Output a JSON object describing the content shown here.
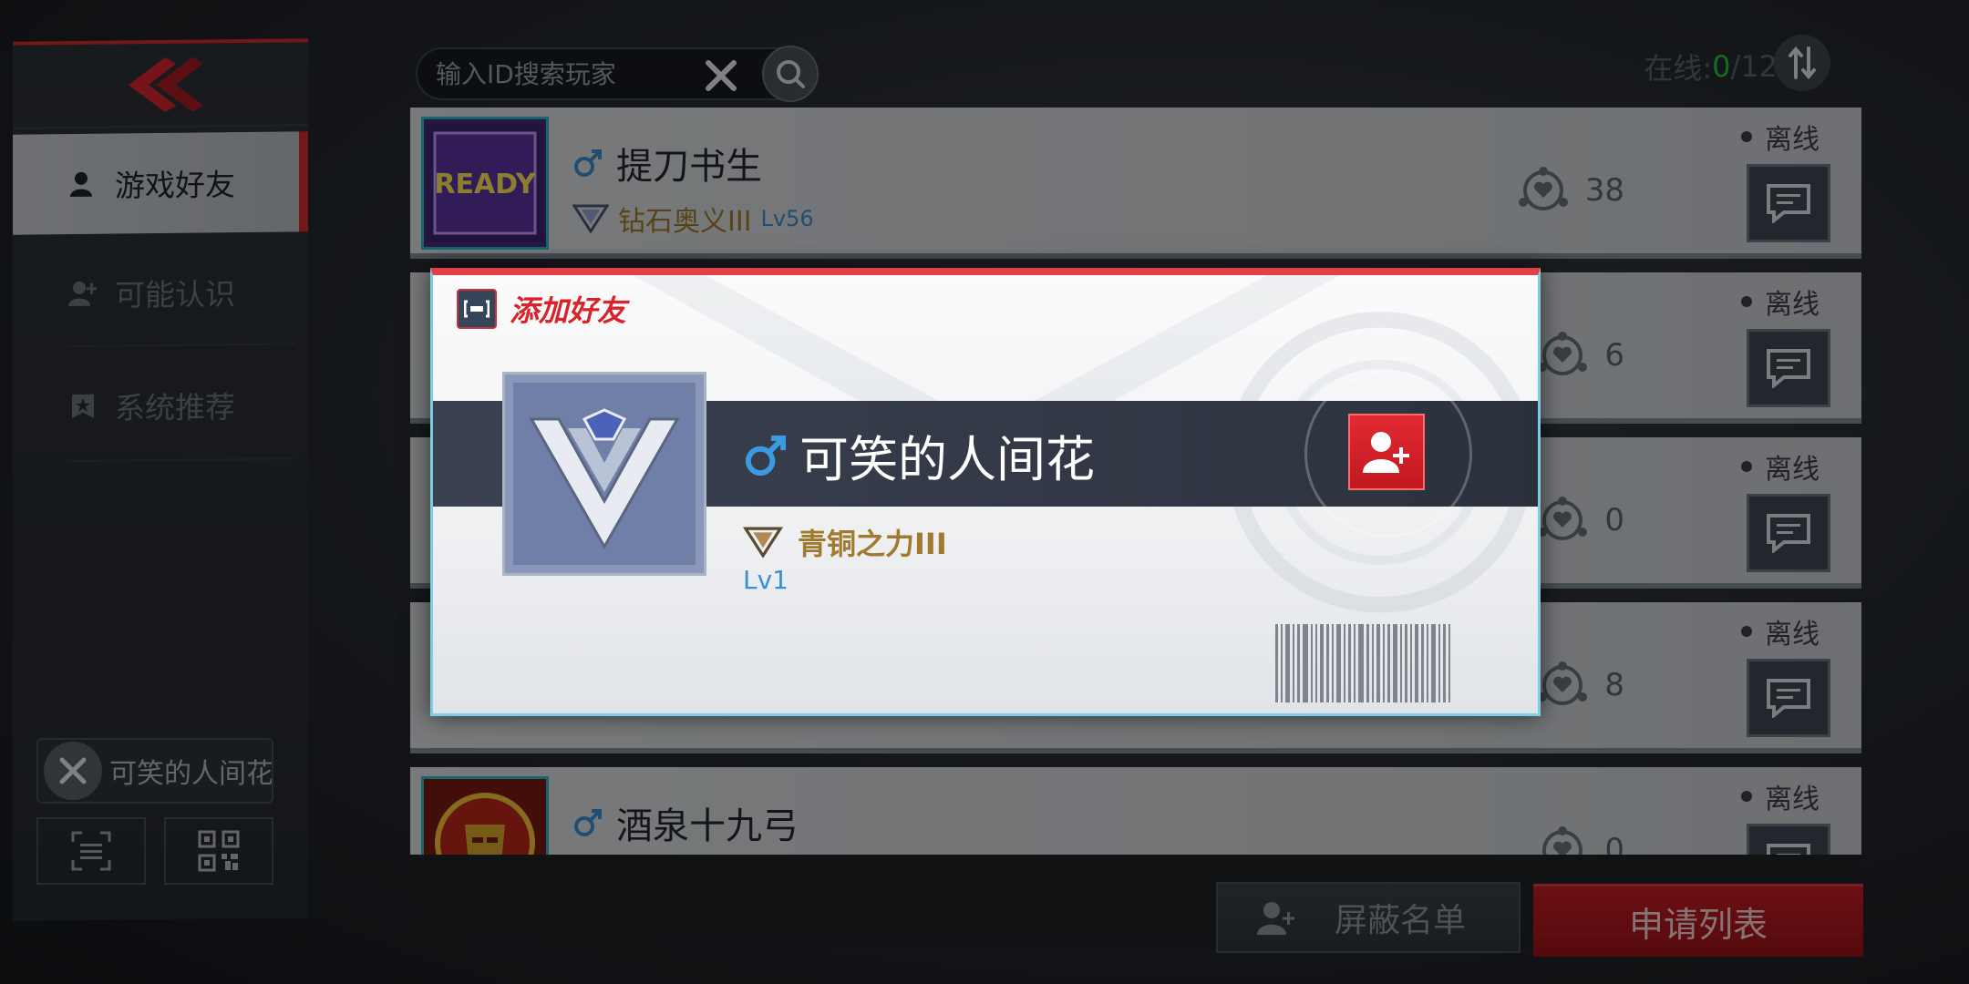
{
  "search": {
    "placeholder": "输入ID搜索玩家"
  },
  "online": {
    "label": "在线: ",
    "count": "0",
    "total": "/12"
  },
  "sidebar": {
    "items": [
      {
        "label": "游戏好友"
      },
      {
        "label": "可能认识"
      },
      {
        "label": "系统推荐"
      }
    ],
    "recent_search": "可笑的人间花"
  },
  "friends": [
    {
      "name": "提刀书生",
      "rank": "钻石奥义III",
      "level": "Lv56",
      "intimacy": "38",
      "status": "离线"
    },
    {
      "intimacy": "6",
      "status": "离线"
    },
    {
      "intimacy": "0",
      "status": "离线"
    },
    {
      "intimacy": "8",
      "status": "离线"
    },
    {
      "name": "酒泉十九弓",
      "intimacy": "0",
      "status": "离线"
    }
  ],
  "buttons": {
    "block_list": "屏蔽名单",
    "apply_list": "申请列表"
  },
  "add_friend_card": {
    "title": "添加好友",
    "name": "可笑的人间花",
    "rank": "青铜之力III",
    "level": "Lv1"
  },
  "colors": {
    "accent_red": "#d42a2a",
    "online_green": "#2fbf3c",
    "rank_gold": "#a17a2e",
    "level_blue": "#3a8fd0"
  }
}
